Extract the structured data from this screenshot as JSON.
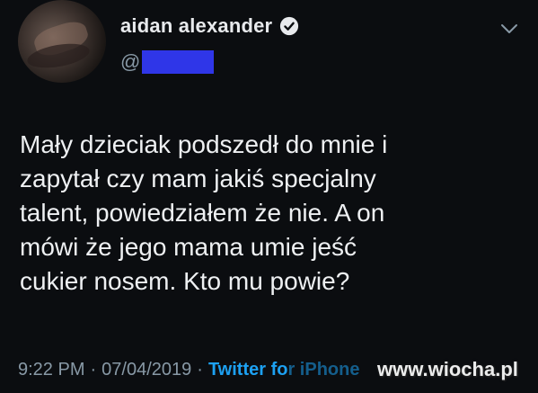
{
  "user": {
    "display_name": "aidan alexander",
    "handle_prefix": "@",
    "verified": true
  },
  "tweet": {
    "text": "Mały dzieciak podszedł do mnie i\nzapytał czy mam jakiś specjalny\ntalent, powiedziałem że nie. A on\nmówi że jego mama umie jeść\ncukier nosem. Kto mu powie?",
    "time": "9:22 PM",
    "separator": "·",
    "date": "07/04/2019",
    "source_visible": "Twitter fo",
    "source_obscured": "r iPhone"
  },
  "watermark": {
    "text": "www.wiocha.pl"
  },
  "icons": {
    "verified": "verified-badge-icon",
    "menu": "chevron-down-icon"
  },
  "colors": {
    "background": "#0b0d10",
    "text": "#eef0f2",
    "muted": "#8899a6",
    "link": "#1da1f2",
    "redaction": "#2f36e8"
  }
}
